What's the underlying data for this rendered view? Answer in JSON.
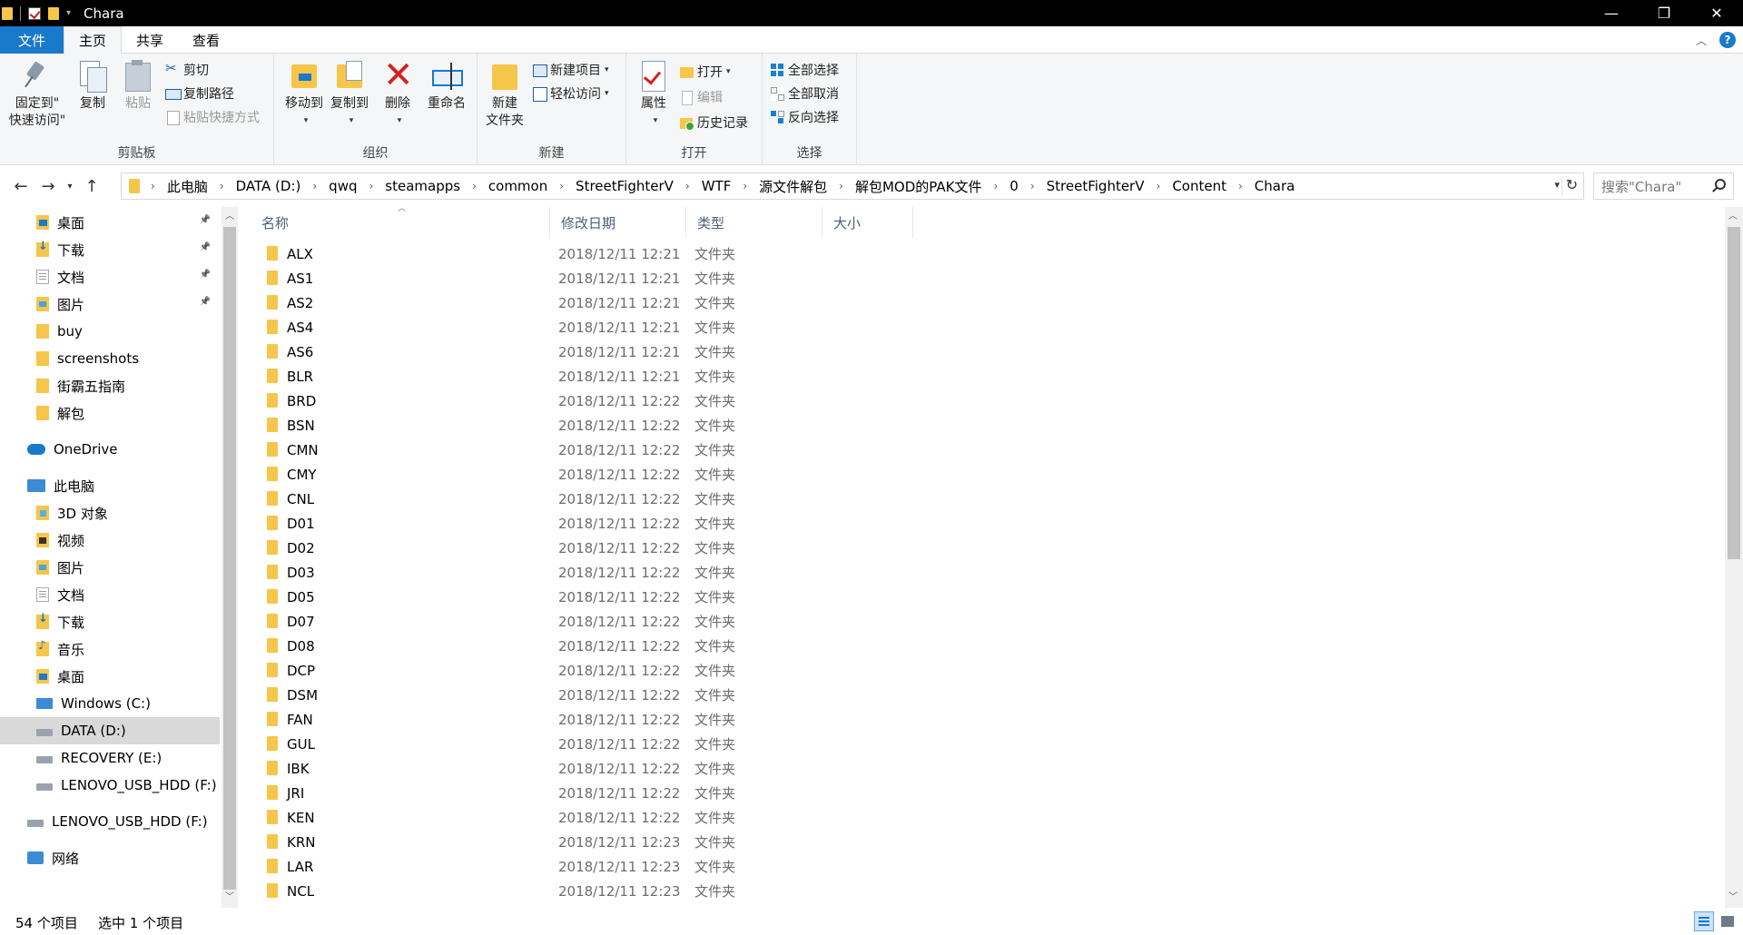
{
  "window": {
    "title": "Chara",
    "controls": {
      "minimize": "—",
      "maximize": "❐",
      "close": "✕"
    }
  },
  "ribbon_tabs": [
    "文件",
    "主页",
    "共享",
    "查看"
  ],
  "ribbon": {
    "clipboard": {
      "label": "剪贴板",
      "pin_line1": "固定到\"",
      "pin_line2": "快速访问\"",
      "copy": "复制",
      "paste": "粘贴",
      "cut": "剪切",
      "copy_path": "复制路径",
      "paste_shortcut": "粘贴快捷方式"
    },
    "organize": {
      "label": "组织",
      "move_to": "移动到",
      "copy_to": "复制到",
      "delete": "删除",
      "rename": "重命名"
    },
    "new": {
      "label": "新建",
      "new_folder_line1": "新建",
      "new_folder_line2": "文件夹",
      "new_item": "新建项目",
      "easy_access": "轻松访问"
    },
    "open": {
      "label": "打开",
      "properties": "属性",
      "open": "打开",
      "edit": "编辑",
      "history": "历史记录"
    },
    "select": {
      "label": "选择",
      "select_all": "全部选择",
      "select_none": "全部取消",
      "invert": "反向选择"
    }
  },
  "address": {
    "crumbs": [
      "此电脑",
      "DATA (D:)",
      "qwq",
      "steamapps",
      "common",
      "StreetFighterV",
      "WTF",
      "源文件解包",
      "解包MOD的PAK文件",
      "0",
      "StreetFighterV",
      "Content",
      "Chara"
    ],
    "search_placeholder": "搜索\"Chara\""
  },
  "nav_pane": [
    {
      "label": "桌面",
      "icon": "desktop-folder-icon",
      "pinned": true
    },
    {
      "label": "下载",
      "icon": "downloads-folder-icon",
      "pinned": true
    },
    {
      "label": "文档",
      "icon": "documents-folder-icon",
      "pinned": true
    },
    {
      "label": "图片",
      "icon": "pictures-folder-icon",
      "pinned": true
    },
    {
      "label": "buy",
      "icon": "folder-icon",
      "pinned": false
    },
    {
      "label": "screenshots",
      "icon": "folder-icon",
      "pinned": false
    },
    {
      "label": "街霸五指南",
      "icon": "folder-icon",
      "pinned": false
    },
    {
      "label": "解包",
      "icon": "folder-icon",
      "pinned": false
    },
    {
      "label": "OneDrive",
      "icon": "onedrive-cloud-icon",
      "pinned": false
    },
    {
      "label": "此电脑",
      "icon": "this-pc-icon",
      "pinned": false
    },
    {
      "label": "3D 对象",
      "icon": "3d-objects-folder-icon",
      "pinned": false
    },
    {
      "label": "视频",
      "icon": "videos-folder-icon",
      "pinned": false
    },
    {
      "label": "图片",
      "icon": "pictures-folder-icon",
      "pinned": false
    },
    {
      "label": "文档",
      "icon": "documents-folder-icon",
      "pinned": false
    },
    {
      "label": "下载",
      "icon": "downloads-folder-icon",
      "pinned": false
    },
    {
      "label": "音乐",
      "icon": "music-folder-icon",
      "pinned": false
    },
    {
      "label": "桌面",
      "icon": "desktop-folder-icon",
      "pinned": false
    },
    {
      "label": "Windows (C:)",
      "icon": "windows-drive-icon",
      "pinned": false
    },
    {
      "label": "DATA (D:)",
      "icon": "drive-icon",
      "pinned": false,
      "selected": true
    },
    {
      "label": "RECOVERY (E:)",
      "icon": "drive-icon",
      "pinned": false
    },
    {
      "label": "LENOVO_USB_HDD (F:)",
      "icon": "drive-icon",
      "pinned": false
    },
    {
      "label": "LENOVO_USB_HDD (F:)",
      "icon": "drive-icon",
      "pinned": false
    },
    {
      "label": "网络",
      "icon": "network-icon",
      "pinned": false
    }
  ],
  "columns": {
    "name": "名称",
    "date": "修改日期",
    "type": "类型",
    "size": "大小"
  },
  "files": [
    {
      "name": "ALX",
      "date": "2018/12/11 12:21",
      "type": "文件夹"
    },
    {
      "name": "AS1",
      "date": "2018/12/11 12:21",
      "type": "文件夹"
    },
    {
      "name": "AS2",
      "date": "2018/12/11 12:21",
      "type": "文件夹"
    },
    {
      "name": "AS4",
      "date": "2018/12/11 12:21",
      "type": "文件夹"
    },
    {
      "name": "AS6",
      "date": "2018/12/11 12:21",
      "type": "文件夹"
    },
    {
      "name": "BLR",
      "date": "2018/12/11 12:21",
      "type": "文件夹"
    },
    {
      "name": "BRD",
      "date": "2018/12/11 12:22",
      "type": "文件夹"
    },
    {
      "name": "BSN",
      "date": "2018/12/11 12:22",
      "type": "文件夹"
    },
    {
      "name": "CMN",
      "date": "2018/12/11 12:22",
      "type": "文件夹"
    },
    {
      "name": "CMY",
      "date": "2018/12/11 12:22",
      "type": "文件夹"
    },
    {
      "name": "CNL",
      "date": "2018/12/11 12:22",
      "type": "文件夹"
    },
    {
      "name": "D01",
      "date": "2018/12/11 12:22",
      "type": "文件夹"
    },
    {
      "name": "D02",
      "date": "2018/12/11 12:22",
      "type": "文件夹"
    },
    {
      "name": "D03",
      "date": "2018/12/11 12:22",
      "type": "文件夹"
    },
    {
      "name": "D05",
      "date": "2018/12/11 12:22",
      "type": "文件夹"
    },
    {
      "name": "D07",
      "date": "2018/12/11 12:22",
      "type": "文件夹"
    },
    {
      "name": "D08",
      "date": "2018/12/11 12:22",
      "type": "文件夹"
    },
    {
      "name": "DCP",
      "date": "2018/12/11 12:22",
      "type": "文件夹"
    },
    {
      "name": "DSM",
      "date": "2018/12/11 12:22",
      "type": "文件夹"
    },
    {
      "name": "FAN",
      "date": "2018/12/11 12:22",
      "type": "文件夹"
    },
    {
      "name": "GUL",
      "date": "2018/12/11 12:22",
      "type": "文件夹"
    },
    {
      "name": "IBK",
      "date": "2018/12/11 12:22",
      "type": "文件夹"
    },
    {
      "name": "JRI",
      "date": "2018/12/11 12:22",
      "type": "文件夹"
    },
    {
      "name": "KEN",
      "date": "2018/12/11 12:22",
      "type": "文件夹"
    },
    {
      "name": "KRN",
      "date": "2018/12/11 12:23",
      "type": "文件夹"
    },
    {
      "name": "LAR",
      "date": "2018/12/11 12:23",
      "type": "文件夹"
    },
    {
      "name": "NCL",
      "date": "2018/12/11 12:23",
      "type": "文件夹"
    }
  ],
  "status": {
    "count": "54 个项目",
    "selected": "选中 1 个项目"
  },
  "colors": {
    "accent": "#1979ca",
    "folder": "#f6c64b",
    "selected_nav": "#d9d9d9"
  }
}
